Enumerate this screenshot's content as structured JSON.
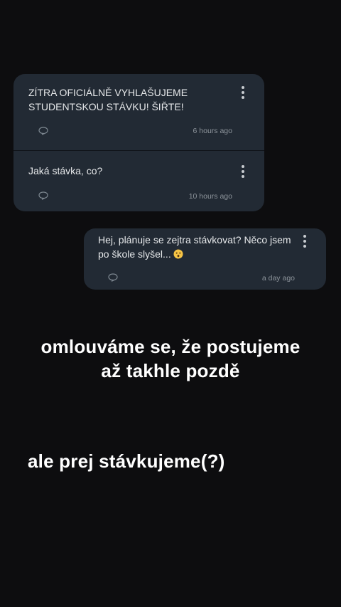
{
  "messages": [
    {
      "text_line1": "ZÍTRA OFICIÁLNĚ VYHLAŠUJEME",
      "text_line2": "STUDENTSKOU STÁVKU! ŠIŘTE!",
      "time": "6 hours ago"
    },
    {
      "text": "Jaká stávka, co?",
      "time": "10 hours ago"
    },
    {
      "text_line1": "Hej, plánuje se zejtra stávkovat? Něco jsem",
      "text_line2": "po škole slyšel...",
      "emoji": "hushed-face",
      "time": "a day ago"
    }
  ],
  "captions": {
    "line1": "omlouváme se, že postujeme",
    "line2": "až takhle pozdě",
    "line3": "ale prej stávkujeme(?)"
  },
  "colors": {
    "background": "#0d0d0f",
    "card": "#222a34",
    "caption_text": "#ffffff",
    "meta_text": "#8d949b"
  }
}
